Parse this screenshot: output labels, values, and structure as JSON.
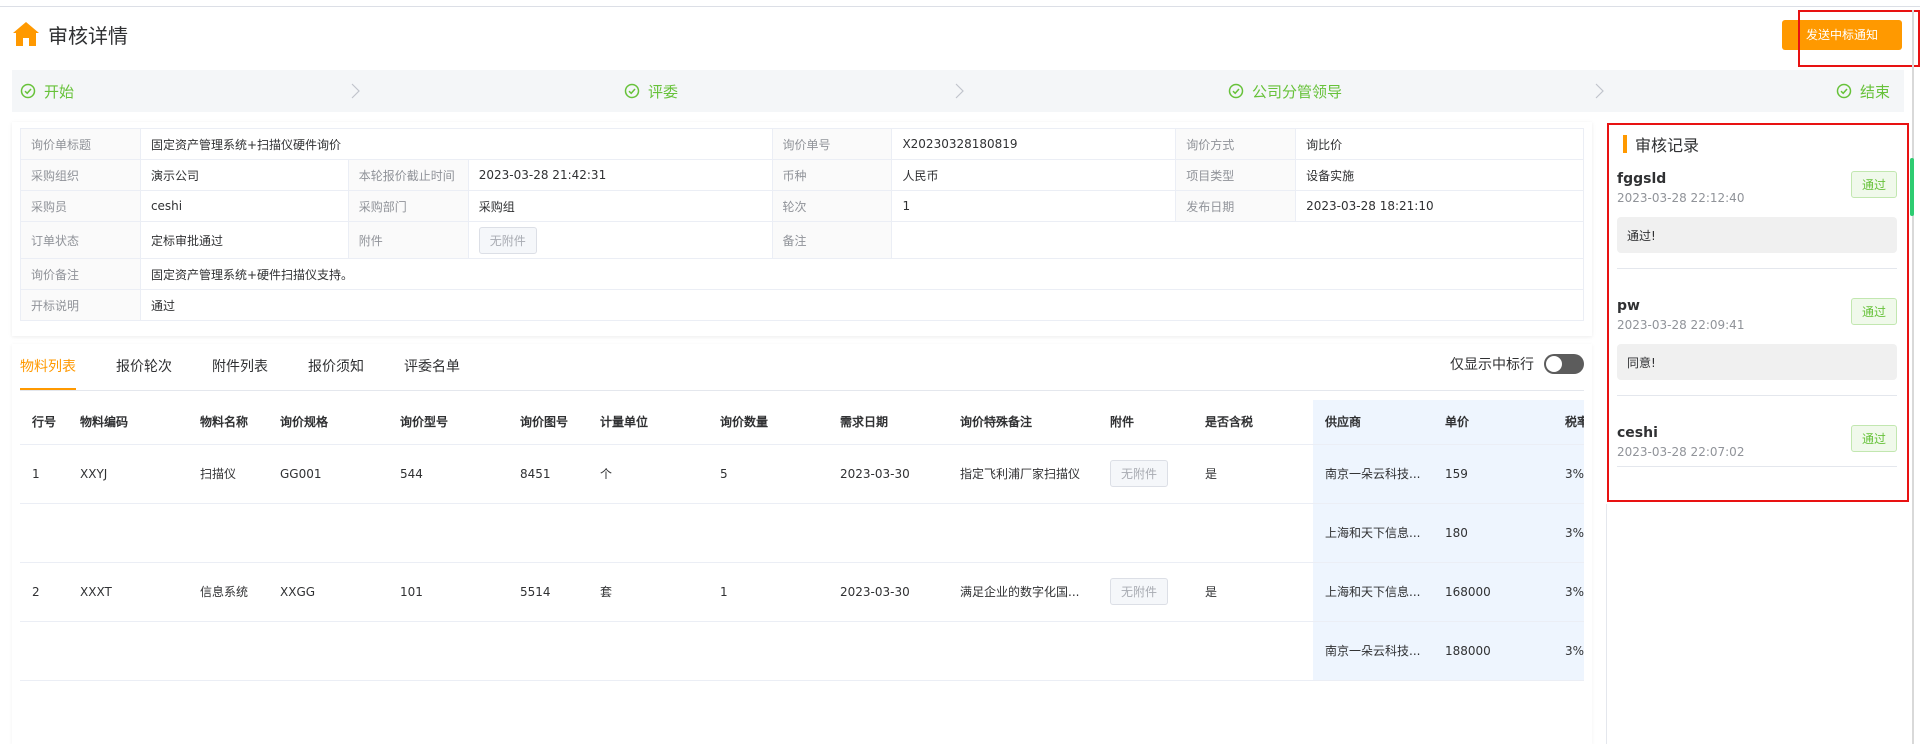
{
  "header": {
    "title": "审核详情",
    "send_button": "发送中标通知"
  },
  "steps": [
    "开始",
    "评委",
    "公司分管领导",
    "结束"
  ],
  "info": {
    "rows": [
      [
        [
          "询价单标题",
          "固定资产管理系统+扫描仪硬件询价"
        ],
        [
          "询价单号",
          "X20230328180819"
        ],
        [
          "询价方式",
          "询比价"
        ]
      ],
      [
        [
          "采购组织",
          "演示公司"
        ],
        [
          "本轮报价截止时间",
          "2023-03-28 21:42:31"
        ],
        [
          "币种",
          "人民币"
        ],
        [
          "项目类型",
          "设备实施"
        ]
      ],
      [
        [
          "采购员",
          "ceshi"
        ],
        [
          "采购部门",
          "采购组"
        ],
        [
          "轮次",
          "1"
        ],
        [
          "发布日期",
          "2023-03-28 18:21:10"
        ]
      ],
      [
        [
          "订单状态",
          "定标审批通过"
        ],
        [
          "附件",
          "无附件"
        ],
        [
          "备注",
          ""
        ]
      ],
      [
        [
          "询价备注",
          "固定资产管理系统+硬件扫描仪支持。"
        ]
      ],
      [
        [
          "开标说明",
          "通过"
        ]
      ]
    ]
  },
  "tabs": [
    "物料列表",
    "报价轮次",
    "附件列表",
    "报价须知",
    "评委名单"
  ],
  "toggle_label": "仅显示中标行",
  "materials": {
    "headers": [
      "行号",
      "物料编码",
      "物料名称",
      "询价规格",
      "询价型号",
      "询价图号",
      "计量单位",
      "询价数量",
      "需求日期",
      "询价特殊备注",
      "附件",
      "是否含税",
      "供应商",
      "单价",
      "税率"
    ],
    "rows": [
      [
        "1",
        "XXYJ",
        "扫描仪",
        "GG001",
        "544",
        "8451",
        "个",
        "5",
        "2023-03-30",
        "指定飞利浦厂家扫描仪",
        "无附件",
        "是",
        "南京一朵云科技...",
        "159",
        "3%"
      ],
      [
        "",
        "",
        "",
        "",
        "",
        "",
        "",
        "",
        "",
        "",
        "",
        "",
        "上海和天下信息...",
        "180",
        "3%"
      ],
      [
        "2",
        "XXXT",
        "信息系统",
        "XXGG",
        "101",
        "5514",
        "套",
        "1",
        "2023-03-30",
        "满足企业的数字化国...",
        "无附件",
        "是",
        "上海和天下信息...",
        "168000",
        "3%"
      ],
      [
        "",
        "",
        "",
        "",
        "",
        "",
        "",
        "",
        "",
        "",
        "",
        "",
        "南京一朵云科技...",
        "188000",
        "3%"
      ]
    ]
  },
  "audit": {
    "title": "审核记录",
    "records": [
      {
        "name": "fggsld",
        "time": "2023-03-28 22:12:40",
        "status": "通过",
        "message": "通过!"
      },
      {
        "name": "pw",
        "time": "2023-03-28 22:09:41",
        "status": "通过",
        "message": "同意!"
      },
      {
        "name": "ceshi",
        "time": "2023-03-28 22:07:02",
        "status": "通过",
        "message": ""
      }
    ]
  },
  "colors": {
    "accent": "#ff9900",
    "success": "#67c23a",
    "highlight_border": "#e81212",
    "supplier_bg": "#eef5fe"
  }
}
